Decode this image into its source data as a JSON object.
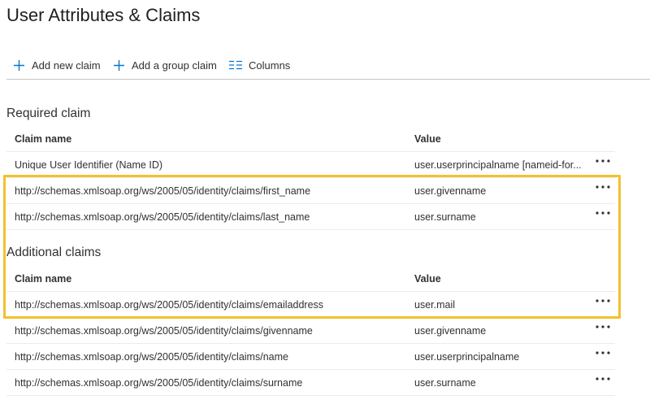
{
  "page": {
    "title": "User Attributes & Claims"
  },
  "toolbar": {
    "add_new_claim": "Add new claim",
    "add_group_claim": "Add a group claim",
    "columns": "Columns"
  },
  "required": {
    "title": "Required claim",
    "headers": {
      "name": "Claim name",
      "value": "Value"
    },
    "rows": [
      {
        "name": "Unique User Identifier (Name ID)",
        "value": "user.userprincipalname [nameid-for..."
      },
      {
        "name": "http://schemas.xmlsoap.org/ws/2005/05/identity/claims/first_name",
        "value": "user.givenname"
      },
      {
        "name": "http://schemas.xmlsoap.org/ws/2005/05/identity/claims/last_name",
        "value": "user.surname"
      }
    ]
  },
  "additional": {
    "title": "Additional claims",
    "headers": {
      "name": "Claim name",
      "value": "Value"
    },
    "rows": [
      {
        "name": "http://schemas.xmlsoap.org/ws/2005/05/identity/claims/emailaddress",
        "value": "user.mail"
      },
      {
        "name": "http://schemas.xmlsoap.org/ws/2005/05/identity/claims/givenname",
        "value": "user.givenname"
      },
      {
        "name": "http://schemas.xmlsoap.org/ws/2005/05/identity/claims/name",
        "value": "user.userprincipalname"
      },
      {
        "name": "http://schemas.xmlsoap.org/ws/2005/05/identity/claims/surname",
        "value": "user.surname"
      }
    ]
  },
  "icons": {
    "add": "plus-icon",
    "columns": "columns-icon",
    "more": "ellipsis-icon"
  },
  "colors": {
    "accent": "#0078d4",
    "highlight": "#f2c12e",
    "divider": "#edebe9"
  }
}
